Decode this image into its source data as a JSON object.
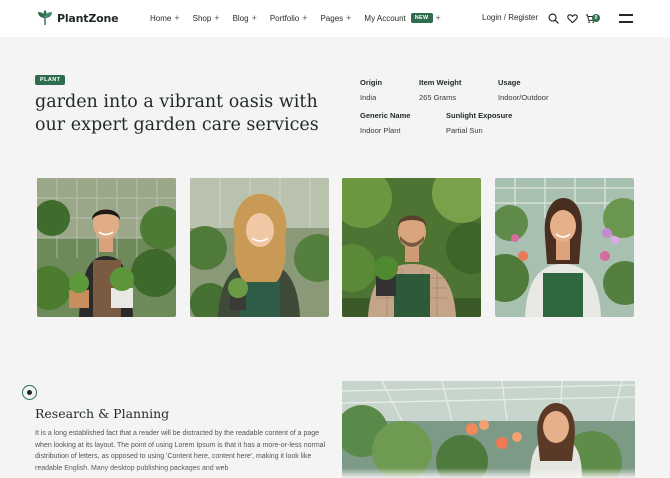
{
  "brand": {
    "name": "PlantZone",
    "icon": "plant-logo-icon"
  },
  "nav": {
    "items": [
      {
        "label": "Home",
        "suffix": "+"
      },
      {
        "label": "Shop",
        "suffix": "+"
      },
      {
        "label": "Blog",
        "suffix": "+"
      },
      {
        "label": "Portfolio",
        "suffix": "+"
      },
      {
        "label": "Pages",
        "suffix": "+"
      },
      {
        "label": "My Account",
        "badge": "NEW",
        "suffix": "+"
      }
    ]
  },
  "header": {
    "login_label": "Login / Register",
    "cart_count": "0",
    "icons": [
      "search-icon",
      "heart-icon",
      "cart-icon",
      "menu-icon"
    ]
  },
  "hero": {
    "tag": "PLANT",
    "title": "garden into a vibrant oasis with our expert garden care services"
  },
  "specs": [
    {
      "label": "Origin",
      "value": "India"
    },
    {
      "label": "Item Weight",
      "value": "265 Grams"
    },
    {
      "label": "Usage",
      "value": "Indoor/Outdoor"
    },
    {
      "label": "Generic Name",
      "value": "Indoor Plant"
    },
    {
      "label": "Sunlight Exposure",
      "value": "Partial Sun"
    }
  ],
  "research": {
    "title": "Research & Planning",
    "body": "It is a long established fact that a reader will be distracted by the readable content of a page when looking at its layout. The point of using Lorem Ipsum is that it has a more-or-less normal distribution of letters, as opposed to using 'Content here, content here', making it look like readable English. Many desktop publishing packages and web"
  },
  "colors": {
    "accent": "#2f6d4f",
    "background": "#f4f4f4",
    "text": "#1f2a22"
  }
}
